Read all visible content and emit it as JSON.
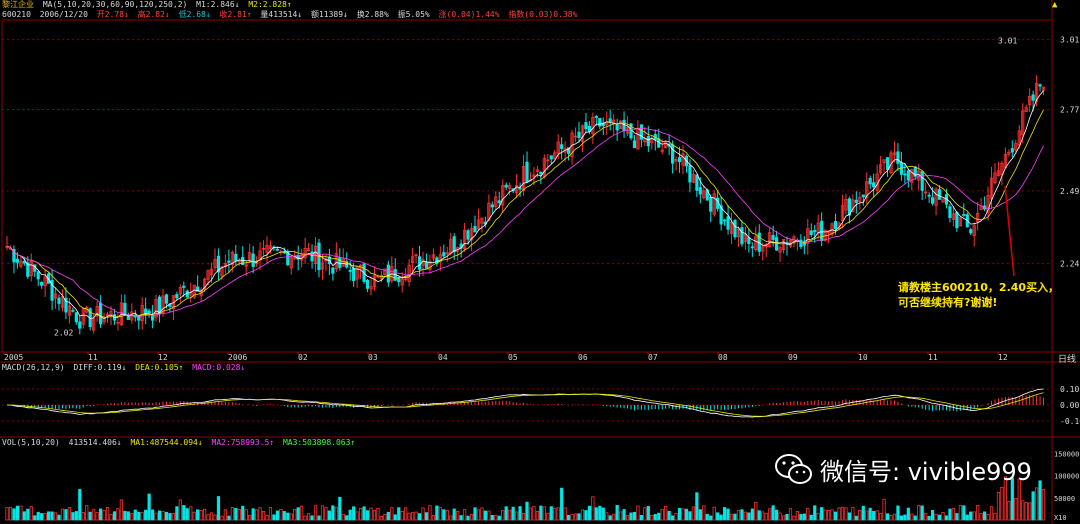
{
  "header": {
    "stock_name": "黎江企业",
    "ma_label": "MA(5,10,20,30,60,90,120,250,2)",
    "m1": "M1:2.846↓",
    "m2": "M2:2.828↑",
    "code": "600210",
    "date": "2006/12/20",
    "open": "开2.78↓",
    "high": "高2.82↓",
    "low": "低2.68↓",
    "close": "收2.81↑",
    "volume": "量413514↓",
    "amount": "额11389↓",
    "turnover": "换2.88%",
    "amplitude": "振5.05%",
    "change": "涨(0.04)1.44%",
    "index": "指数(0.03)0.38%"
  },
  "price_axis": {
    "labels": [
      "3.01",
      "2.77",
      "2.49",
      "2.24",
      "2.02"
    ],
    "high_mark": "3.01",
    "low_mark": "2.02"
  },
  "time_axis": [
    "2005",
    "11",
    "12",
    "2006",
    "02",
    "03",
    "04",
    "05",
    "06",
    "07",
    "08",
    "09",
    "10",
    "11",
    "12"
  ],
  "period_label": "日线",
  "macd": {
    "label": "MACD(26,12,9)",
    "diff": "DIFF:0.119↓",
    "dea": "DEA:0.105↑",
    "macd": "MACD:0.028↓",
    "axis": [
      "0.10",
      "0.00",
      "-0.10"
    ]
  },
  "vol": {
    "label": "VOL(5,10,20)",
    "value": "413514.406↓",
    "ma1": "MA1:487544.094↓",
    "ma2": "MA2:758993.5↑",
    "ma3": "MA3:503898.063↑",
    "axis": [
      "150000",
      "100000",
      "50000",
      "X10"
    ]
  },
  "annotation": {
    "line1": "请教楼主600210，2.40买入，",
    "line2": "可否继续持有?谢谢!"
  },
  "watermark": {
    "text": "微信号: vivible999",
    "icon": "wechat-icon"
  },
  "colors": {
    "up": "#ff3030",
    "down": "#00e5e5",
    "ma": "#e6e600",
    "grid": "#8b0000"
  },
  "chart_data": {
    "type": "line",
    "title": "",
    "y_range": [
      2.02,
      3.01
    ],
    "x": [
      "2005-10",
      "2005-11",
      "2005-12",
      "2006-01",
      "2006-02",
      "2006-03",
      "2006-04",
      "2006-05",
      "2006-06",
      "2006-07",
      "2006-08",
      "2006-09",
      "2006-10",
      "2006-11",
      "2006-12"
    ],
    "series": [
      {
        "values": [
          2.3,
          2.05,
          2.08,
          2.25,
          2.28,
          2.18,
          2.3,
          2.55,
          2.72,
          2.62,
          2.3,
          2.35,
          2.6,
          2.35,
          2.88
        ]
      }
    ]
  }
}
